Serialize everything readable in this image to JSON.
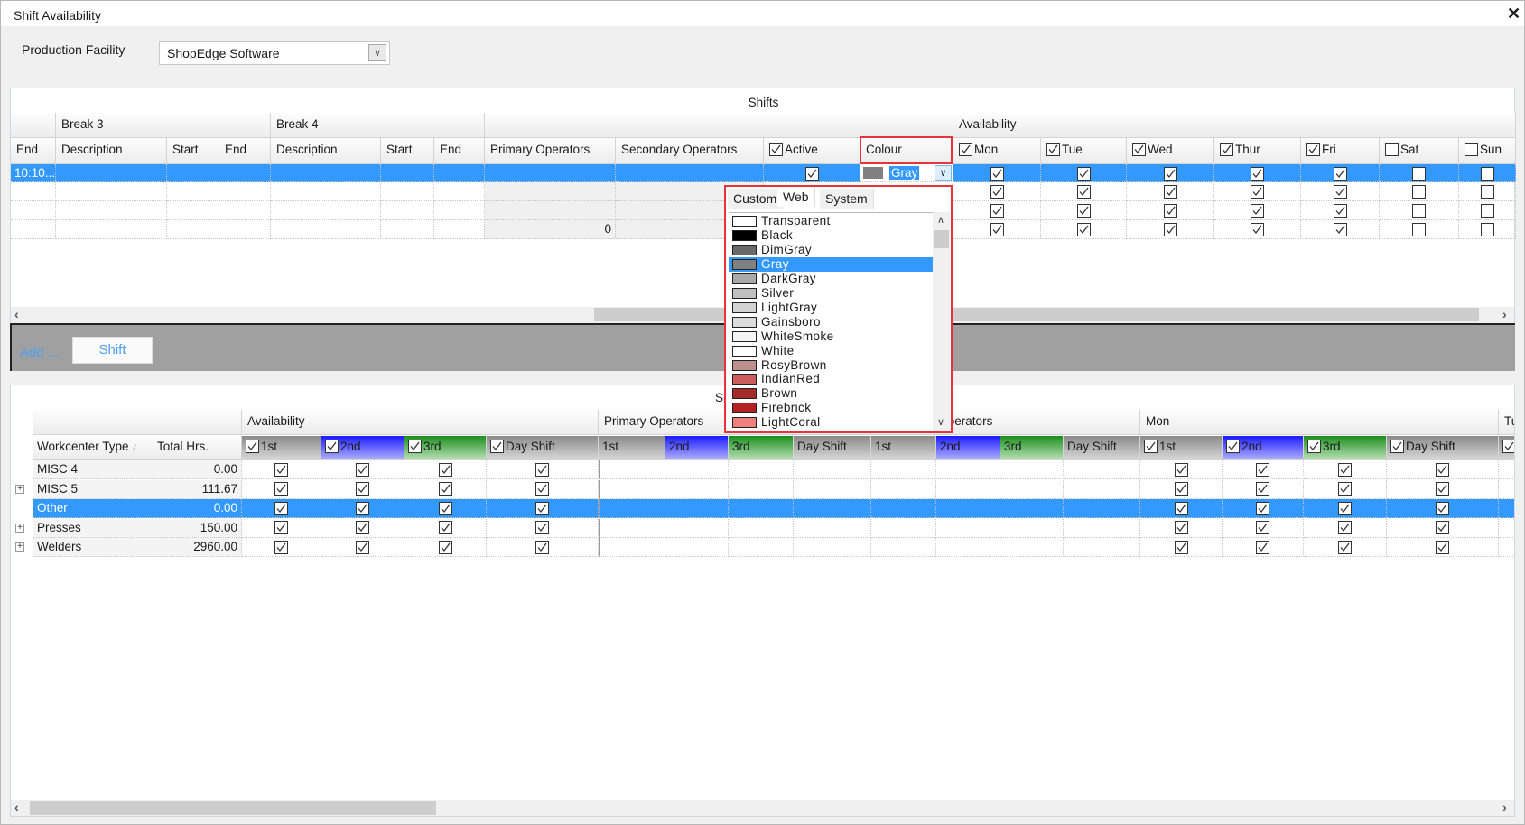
{
  "window": {
    "tab_title": "Shift Availability",
    "close_icon": "close-icon"
  },
  "facility": {
    "label": "Production Facility",
    "value": "ShopEdge Software"
  },
  "shifts_grid": {
    "title": "Shifts",
    "groups": [
      {
        "label": "",
        "span": 1
      },
      {
        "label": "Break 3",
        "span": 3
      },
      {
        "label": "Break 4",
        "span": 3
      },
      {
        "label": "",
        "span": 4
      },
      {
        "label": "Availability",
        "span": 7
      }
    ],
    "columns": [
      {
        "label": "End"
      },
      {
        "label": "Description"
      },
      {
        "label": "Start"
      },
      {
        "label": "End"
      },
      {
        "label": "Description"
      },
      {
        "label": "Start"
      },
      {
        "label": "End"
      },
      {
        "label": "Primary Operators"
      },
      {
        "label": "Secondary Operators"
      },
      {
        "label": "Active",
        "checked": true
      },
      {
        "label": "Colour"
      },
      {
        "label": "Mon",
        "checked": true
      },
      {
        "label": "Tue",
        "checked": true
      },
      {
        "label": "Wed",
        "checked": true
      },
      {
        "label": "Thur",
        "checked": true
      },
      {
        "label": "Fri",
        "checked": true
      },
      {
        "label": "Sat",
        "checked": false
      },
      {
        "label": "Sun",
        "checked": false
      }
    ],
    "rows": [
      {
        "selected": true,
        "end": "10:10...",
        "primary": "",
        "active": true,
        "colour": "Gray",
        "colour_hex": "#808080",
        "days": [
          true,
          true,
          true,
          true,
          true,
          false,
          false
        ]
      },
      {
        "selected": false,
        "end": "",
        "primary": "",
        "days": [
          true,
          true,
          true,
          true,
          true,
          false,
          false
        ]
      },
      {
        "selected": false,
        "end": "",
        "primary": "",
        "days": [
          true,
          true,
          true,
          true,
          true,
          false,
          false
        ]
      },
      {
        "selected": false,
        "end": "",
        "primary": "0",
        "days": [
          true,
          true,
          true,
          true,
          true,
          false,
          false
        ]
      }
    ]
  },
  "add_bar": {
    "label": "Add ...",
    "shift_button": "Shift"
  },
  "colour_picker": {
    "tabs": [
      "Custom",
      "Web",
      "System"
    ],
    "active_tab": "Web",
    "selected": "Gray",
    "items": [
      {
        "name": "Transparent",
        "hex": "#ffffff"
      },
      {
        "name": "Black",
        "hex": "#000000"
      },
      {
        "name": "DimGray",
        "hex": "#696969"
      },
      {
        "name": "Gray",
        "hex": "#808080"
      },
      {
        "name": "DarkGray",
        "hex": "#a9a9a9"
      },
      {
        "name": "Silver",
        "hex": "#c0c0c0"
      },
      {
        "name": "LightGray",
        "hex": "#d3d3d3"
      },
      {
        "name": "Gainsboro",
        "hex": "#dcdcdc"
      },
      {
        "name": "WhiteSmoke",
        "hex": "#f5f5f5"
      },
      {
        "name": "White",
        "hex": "#ffffff"
      },
      {
        "name": "RosyBrown",
        "hex": "#bc8f8f"
      },
      {
        "name": "IndianRed",
        "hex": "#cd5c5c"
      },
      {
        "name": "Brown",
        "hex": "#a52a2a"
      },
      {
        "name": "Firebrick",
        "hex": "#b22222"
      },
      {
        "name": "LightCoral",
        "hex": "#f08080"
      }
    ]
  },
  "workcenter_grid": {
    "title": "Shifts",
    "groups": [
      "",
      "Availability",
      "Primary Operators",
      "Secondary Operators",
      "Mon",
      "Tue"
    ],
    "columns": [
      {
        "label": "Workcenter Type",
        "sort": "asc"
      },
      {
        "label": "Total Hrs."
      },
      {
        "label": "1st",
        "checked": true,
        "shift": "1st"
      },
      {
        "label": "2nd",
        "checked": true,
        "shift": "2nd"
      },
      {
        "label": "3rd",
        "checked": true,
        "shift": "3rd"
      },
      {
        "label": "Day Shift",
        "checked": true,
        "shift": "day"
      },
      {
        "label": "1st",
        "shift": "1st"
      },
      {
        "label": "2nd",
        "shift": "2nd"
      },
      {
        "label": "3rd",
        "shift": "3rd"
      },
      {
        "label": "Day Shift",
        "shift": "day"
      },
      {
        "label": "1st",
        "shift": "1st"
      },
      {
        "label": "2nd",
        "shift": "2nd"
      },
      {
        "label": "3rd",
        "shift": "3rd"
      },
      {
        "label": "Day Shift",
        "shift": "day"
      },
      {
        "label": "1st",
        "checked": true,
        "shift": "1st"
      },
      {
        "label": "2nd",
        "checked": true,
        "shift": "2nd"
      },
      {
        "label": "3rd",
        "checked": true,
        "shift": "3rd"
      },
      {
        "label": "Day Shift",
        "checked": true,
        "shift": "day"
      },
      {
        "label": "",
        "checked": true,
        "shift": "1st"
      }
    ],
    "rows": [
      {
        "name": "MISC 4",
        "hours": "0.00",
        "expandable": false,
        "selected": false,
        "availability": [
          true,
          true,
          true,
          true
        ],
        "mon": [
          true,
          true,
          true,
          true
        ]
      },
      {
        "name": "MISC 5",
        "hours": "111.67",
        "expandable": true,
        "selected": false,
        "availability": [
          true,
          true,
          true,
          true
        ],
        "mon": [
          true,
          true,
          true,
          true
        ]
      },
      {
        "name": "Other",
        "hours": "0.00",
        "expandable": false,
        "selected": true,
        "availability": [
          true,
          true,
          true,
          true
        ],
        "mon": [
          true,
          true,
          true,
          true
        ]
      },
      {
        "name": "Presses",
        "hours": "150.00",
        "expandable": true,
        "selected": false,
        "availability": [
          true,
          true,
          true,
          true
        ],
        "mon": [
          true,
          true,
          true,
          true
        ]
      },
      {
        "name": "Welders",
        "hours": "2960.00",
        "expandable": true,
        "selected": false,
        "availability": [
          true,
          true,
          true,
          true
        ],
        "mon": [
          true,
          true,
          true,
          true
        ]
      }
    ]
  },
  "colors": {
    "selection": "#3399ff",
    "highlight": "#e8333d",
    "shift_2nd": "#1a1aff",
    "shift_3rd": "#1a8f1a",
    "link": "#4a9ff5"
  }
}
